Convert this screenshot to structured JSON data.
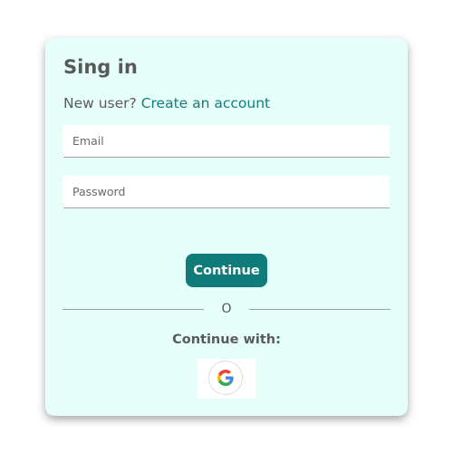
{
  "signin": {
    "title": "Sing in",
    "new_user_text": "New user? ",
    "create_account_link": "Create an account",
    "email_placeholder": "Email",
    "password_placeholder": "Password",
    "continue_label": "Continue",
    "divider_text": "O",
    "continue_with_label": "Continue with:",
    "social_provider_icon": "google-icon"
  },
  "colors": {
    "card_background": "#e6fffb",
    "accent": "#107c7a",
    "link": "#147b7b",
    "text": "#595959"
  }
}
